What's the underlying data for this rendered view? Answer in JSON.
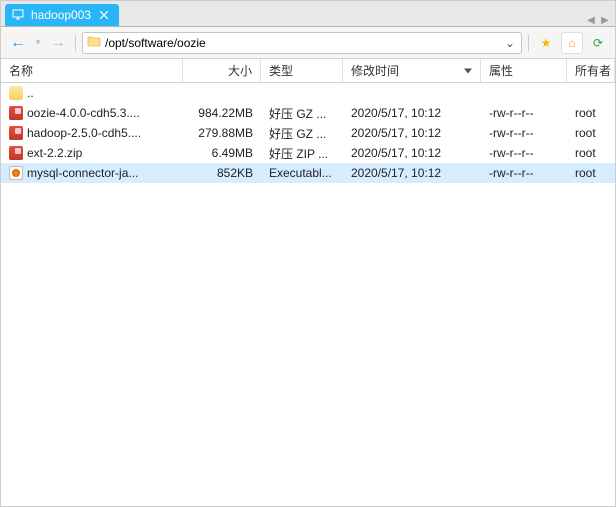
{
  "tab": {
    "title": "hadoop003"
  },
  "path": {
    "value": "/opt/software/oozie"
  },
  "tab_arrows": {
    "prev": "◀",
    "next": "▶"
  },
  "nav": {
    "back": "←",
    "fwd": "→",
    "star": "★",
    "home": "⌂",
    "refresh": "⟳",
    "drop": "⌄",
    "fwd_sep": "▾"
  },
  "cols": {
    "name": "名称",
    "size": "大小",
    "type": "类型",
    "mtime": "修改时间",
    "attrs": "属性",
    "owner": "所有者"
  },
  "parent": {
    "label": ".."
  },
  "files": [
    {
      "name": "oozie-4.0.0-cdh5.3....",
      "size": "984.22MB",
      "type": "好压 GZ ...",
      "mtime": "2020/5/17, 10:12",
      "attrs": "-rw-r--r--",
      "owner": "root",
      "icon": "fi-arc"
    },
    {
      "name": "hadoop-2.5.0-cdh5....",
      "size": "279.88MB",
      "type": "好压 GZ ...",
      "mtime": "2020/5/17, 10:12",
      "attrs": "-rw-r--r--",
      "owner": "root",
      "icon": "fi-arc"
    },
    {
      "name": "ext-2.2.zip",
      "size": "6.49MB",
      "type": "好压 ZIP ...",
      "mtime": "2020/5/17, 10:12",
      "attrs": "-rw-r--r--",
      "owner": "root",
      "icon": "fi-arc"
    },
    {
      "name": "mysql-connector-ja...",
      "size": "852KB",
      "type": "Executabl...",
      "mtime": "2020/5/17, 10:12",
      "attrs": "-rw-r--r--",
      "owner": "root",
      "icon": "fi-jar"
    }
  ],
  "selected_index": 3
}
